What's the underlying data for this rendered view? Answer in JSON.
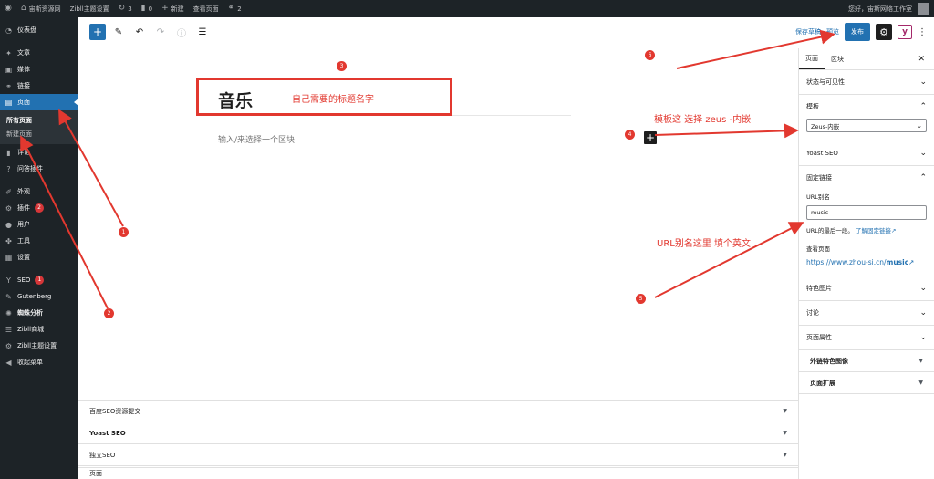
{
  "admin_bar": {
    "site_name": "宙斯资源网",
    "theme_settings": "Zibll主题设置",
    "updates_count": "3",
    "comments_count": "0",
    "new_label": "新建",
    "view_page": "查看页面",
    "links_count": "2",
    "greeting": "您好，宙斯网络工作室"
  },
  "sidebar": {
    "dashboard": "仪表盘",
    "posts": "文章",
    "media": "媒体",
    "links": "链接",
    "pages": "页面",
    "submenu": [
      "所有页面",
      "新建页面"
    ],
    "comments": "评论",
    "qa": "问答插件",
    "appearance": "外观",
    "plugins": "插件",
    "plugins_badge": "2",
    "users": "用户",
    "tools": "工具",
    "settings": "设置",
    "seo": "SEO",
    "seo_badge": "1",
    "gutenberg": "Gutenberg",
    "analytics": "蜘蛛分析",
    "zibll_shop": "Zibll商城",
    "zibll_theme": "Zibll主题设置",
    "collapse": "收起菜单"
  },
  "toolbar": {
    "save_draft": "保存草稿",
    "preview": "预览",
    "publish": "发布"
  },
  "editor": {
    "title": "音乐",
    "placeholder": "输入/来选择一个区块"
  },
  "metaboxes": [
    "百度SEO资源提交",
    "Yoast SEO",
    "独立SEO"
  ],
  "footer_breadcrumb": "页面",
  "settings_sidebar": {
    "tab_page": "页面",
    "tab_block": "区块",
    "status": "状态与可见性",
    "template": "模板",
    "template_value": "Zeus-内嵌",
    "yoast": "Yoast SEO",
    "permalink": "固定链接",
    "url_slug_label": "URL别名",
    "url_slug_value": "music",
    "url_help": "URL的最后一段。",
    "url_help_link": "了解固定链接",
    "view_page_label": "查看页面",
    "permalink_base": "https://www.zhou-si.cn/",
    "permalink_slug": "music",
    "featured_image": "特色图片",
    "discussion": "讨论",
    "page_attributes": "页面属性",
    "external_image": "外链特色图像",
    "page_extension": "页面扩展"
  },
  "annotations": {
    "title_note": "自己需要的标题名字",
    "template_note": "模板这 选择 zeus -内嵌",
    "slug_note": "URL别名这里 填个英文",
    "markers": [
      "1",
      "2",
      "3",
      "4",
      "5",
      "6"
    ]
  },
  "colors": {
    "admin_dark": "#1d2327",
    "wp_blue": "#2271b1",
    "annotation_red": "#e2382f"
  },
  "icons": [
    "wordpress-logo-icon",
    "home-icon",
    "updates-icon",
    "comment-icon",
    "plus-icon",
    "link-icon",
    "pencil-icon",
    "undo-icon",
    "redo-icon",
    "info-icon",
    "list-view-icon",
    "gear-icon",
    "yoast-icon",
    "more-vertical-icon",
    "close-icon",
    "chevron-down-icon",
    "chevron-up-icon"
  ]
}
